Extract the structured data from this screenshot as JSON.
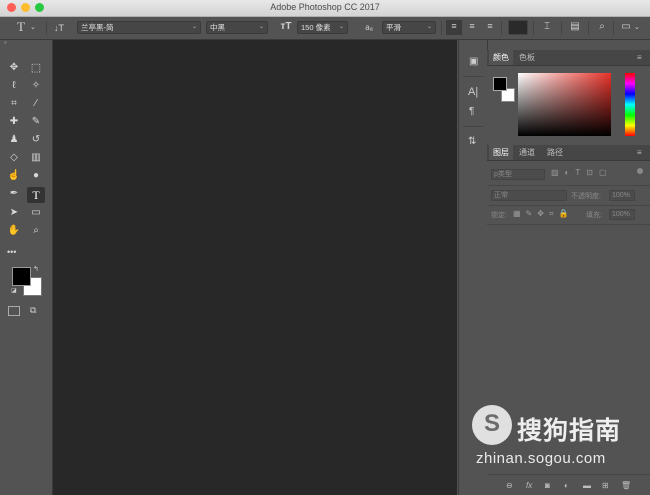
{
  "window": {
    "title": "Adobe Photoshop CC 2017",
    "traffic_lights": [
      "#ff5f57",
      "#febc2e",
      "#28c840"
    ]
  },
  "options_bar": {
    "tool_icon": "T",
    "font_family": "兰亭黑-简",
    "font_style": "中黑",
    "font_size": "150 像素",
    "aa_icon": "aₐ",
    "anti_alias": "平滑",
    "color_swatch": "#2a2a2a"
  },
  "tools": {
    "items": [
      "move-icon",
      "marquee-icon",
      "lasso-icon",
      "magic-wand-icon",
      "crop-icon",
      "eyedropper-icon",
      "healing-icon",
      "brush-icon",
      "stamp-icon",
      "history-brush-icon",
      "eraser-icon",
      "gradient-icon",
      "smudge-icon",
      "dodge-icon",
      "pen-icon",
      "type-icon",
      "path-select-icon",
      "rectangle-icon",
      "hand-icon",
      "zoom-icon"
    ],
    "more": "•••",
    "foreground": "#000000",
    "background": "#ffffff"
  },
  "color_panel": {
    "tabs": [
      "颜色",
      "色板"
    ],
    "active": 0,
    "hue_color": "#e8322a"
  },
  "layers_panel": {
    "tabs": [
      "图层",
      "通道",
      "路径"
    ],
    "active": 0,
    "filter_placeholder": "ρ类型",
    "blend_mode": "正常",
    "opacity_label": "不透明度:",
    "opacity_value": "100%",
    "lock_label": "锁定:",
    "fill_label": "填充:",
    "fill_value": "100%"
  },
  "watermark": {
    "brand": "搜狗指南",
    "url": "zhinan.sogou.com"
  }
}
